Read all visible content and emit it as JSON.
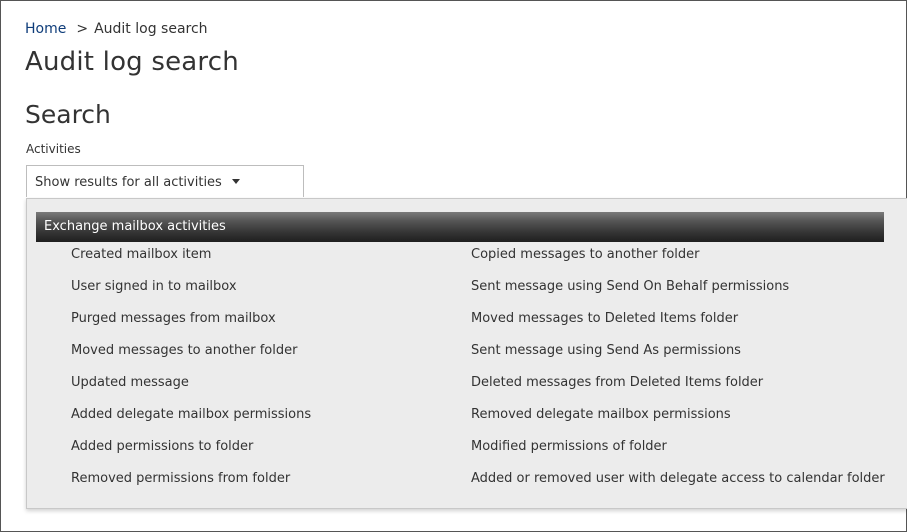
{
  "breadcrumb": {
    "home": "Home",
    "separator": ">",
    "current": "Audit log search"
  },
  "page_title": "Audit log search",
  "search": {
    "section_title": "Search",
    "activities_label": "Activities",
    "activities_selected": "Show results for all activities"
  },
  "panel": {
    "group_title": "Exchange mailbox activities",
    "left_items": [
      "Created mailbox item",
      "User signed in to mailbox",
      "Purged messages from mailbox",
      "Moved messages to another folder",
      "Updated message",
      "Added delegate mailbox permissions",
      "Added permissions to folder",
      "Removed permissions from folder"
    ],
    "right_items": [
      "Copied messages to another folder",
      "Sent message using Send On Behalf permissions",
      "Moved messages to Deleted Items folder",
      "Sent message using Send As permissions",
      "Deleted messages from Deleted Items folder",
      "Removed delegate mailbox permissions",
      "Modified permissions of folder",
      "Added or removed user with delegate access to calendar folder"
    ]
  },
  "colors": {
    "link": "#0f3d7a",
    "text": "#333333",
    "panel_bg": "#ececec",
    "header_dark": "#1f1f1f"
  }
}
